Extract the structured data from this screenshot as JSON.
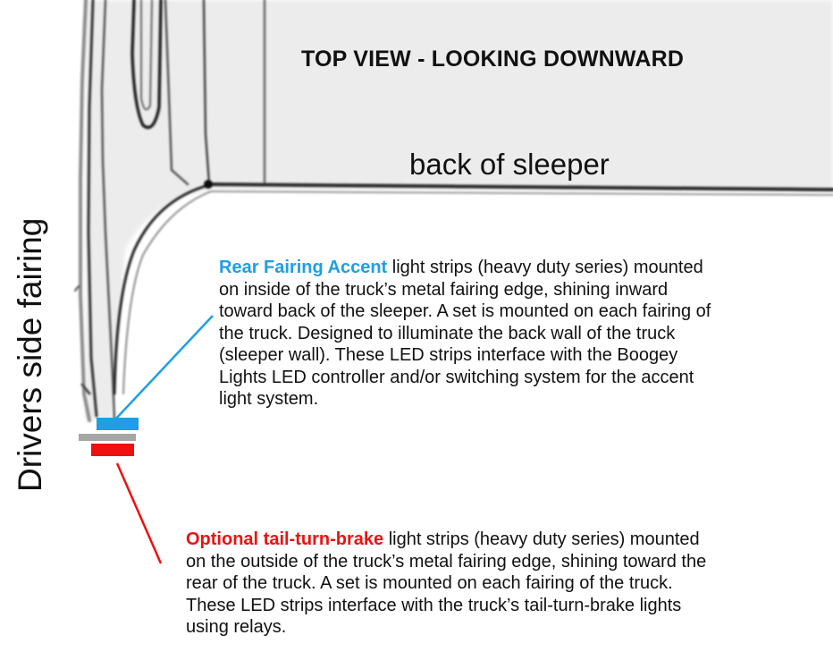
{
  "title": "TOP VIEW - LOOKING DOWNWARD",
  "sleeper_label": "back of sleeper",
  "side_label": "Drivers side fairing",
  "callouts": {
    "accent": {
      "keyword": "Rear Fairing Accent",
      "color": "#1e9ee6",
      "lines": [
        "light strips (heavy duty series) mounted",
        "on inside of the truck’s metal fairing edge, shining inward",
        "toward back of the sleeper. A set is mounted on each fairing of",
        "the truck.  Designed to illuminate the back wall of the truck",
        "(sleeper wall). These LED strips interface with the Boogey",
        "Lights LED controller and/or switching system for the accent",
        "light system."
      ]
    },
    "ttb": {
      "keyword": "Optional tail-turn-brake",
      "color": "#ee1111",
      "lines": [
        "light strips (heavy duty series) mounted",
        "on the outside of the truck’s metal fairing edge, shining toward the",
        "rear of the truck.  A set is mounted on each fairing of the truck.",
        "These LED strips interface with the truck’s tail-turn-brake lights",
        "using relays."
      ]
    }
  },
  "colors": {
    "accent_strip": "#1e9ee6",
    "fairing_edge": "#a6a6a6",
    "ttb_strip": "#ee1111"
  }
}
